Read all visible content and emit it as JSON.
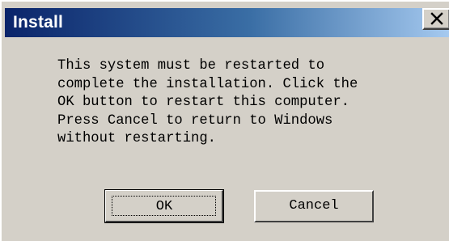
{
  "window": {
    "title": "Install",
    "close_icon": "close-icon",
    "title_color_start": "#0a246a",
    "title_color_end": "#a6caf0",
    "face_color": "#d4d0c8"
  },
  "message": {
    "lines": [
      "This system must be restarted to",
      "complete the installation. Click the",
      "OK button to restart this computer.",
      "Press Cancel to return to Windows",
      "without restarting."
    ]
  },
  "buttons": {
    "ok_label": "OK",
    "cancel_label": "Cancel"
  }
}
